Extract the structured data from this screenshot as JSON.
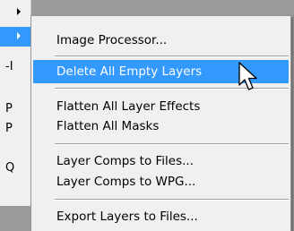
{
  "parent_menu": {
    "items": [
      {
        "label": "",
        "has_arrow": true
      },
      {
        "label": "",
        "has_arrow": true,
        "highlighted": true
      },
      {
        "label": "-I"
      },
      {
        "label": "P"
      },
      {
        "label": "P"
      },
      {
        "label": "Q"
      }
    ]
  },
  "submenu": {
    "items": [
      {
        "label": "Image Processor..."
      },
      {
        "label": "Delete All Empty Layers",
        "selected": true
      },
      {
        "label": "Flatten All Layer Effects"
      },
      {
        "label": "Flatten All Masks"
      },
      {
        "label": "Layer Comps to Files..."
      },
      {
        "label": "Layer Comps to WPG..."
      },
      {
        "label": "Export Layers to Files..."
      }
    ]
  },
  "colors": {
    "highlight": "#3399ff",
    "menu_bg": "#f0f0f0",
    "backdrop": "#9a9a9a"
  },
  "icons": {
    "cursor": "mouse-pointer-icon",
    "submenu_arrow": "submenu-arrow-icon"
  }
}
